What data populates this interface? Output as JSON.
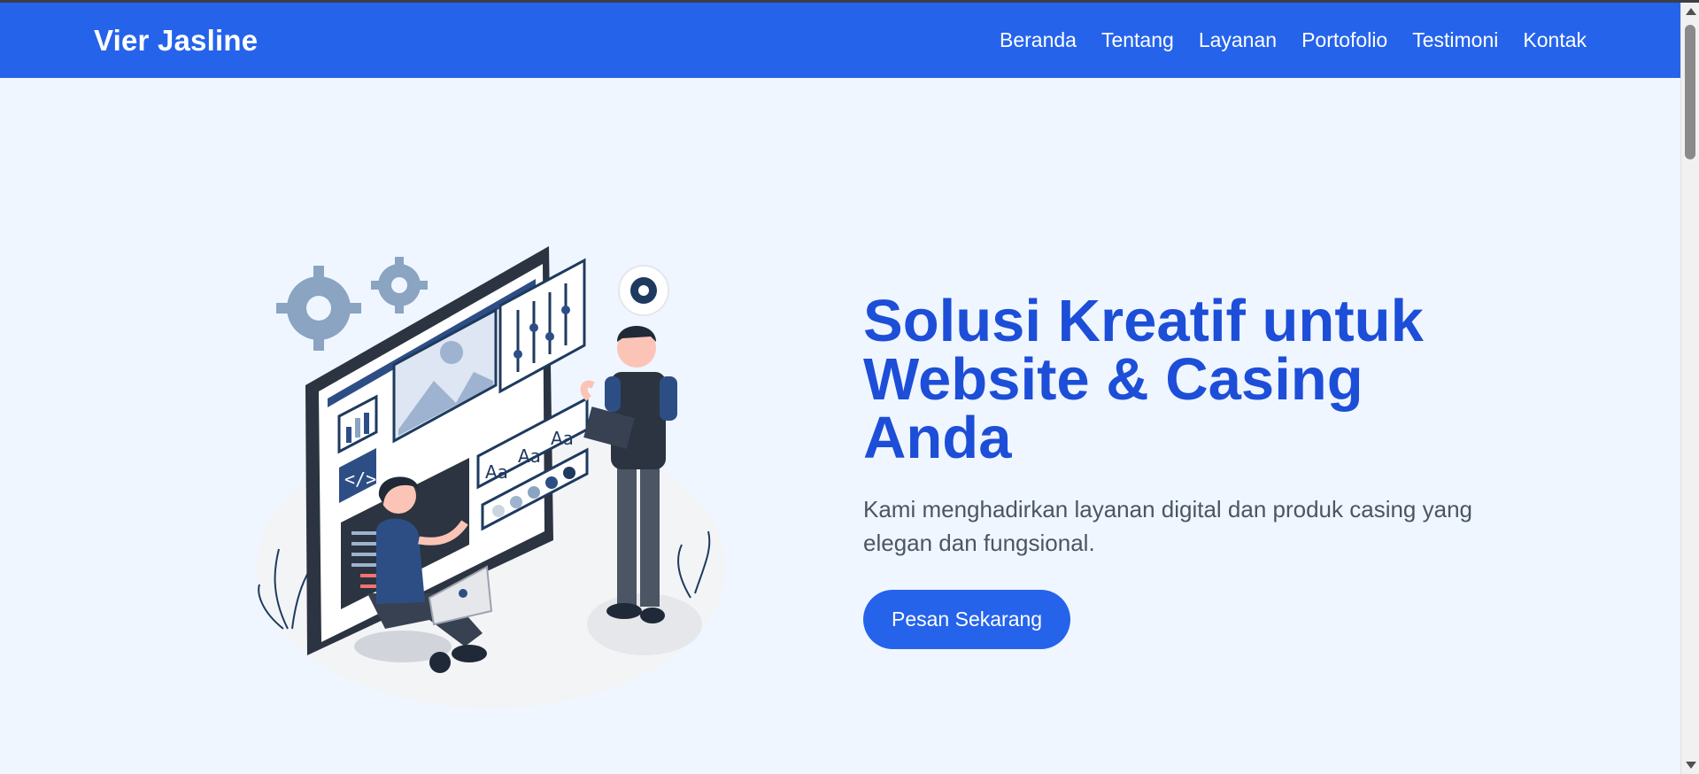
{
  "navbar": {
    "brand": "Vier Jasline",
    "links": [
      "Beranda",
      "Tentang",
      "Layanan",
      "Portofolio",
      "Testimoni",
      "Kontak"
    ]
  },
  "hero": {
    "title": "Solusi Kreatif untuk Website & Casing Anda",
    "subtitle": "Kami menghadirkan layanan digital dan produk casing yang elegan dan fungsional.",
    "cta_label": "Pesan Sekarang",
    "illustration_text": [
      "Aa",
      "Aa",
      "Aa"
    ]
  },
  "colors": {
    "primary": "#2563eb",
    "title": "#1d4ed8",
    "background": "#eff6ff"
  }
}
